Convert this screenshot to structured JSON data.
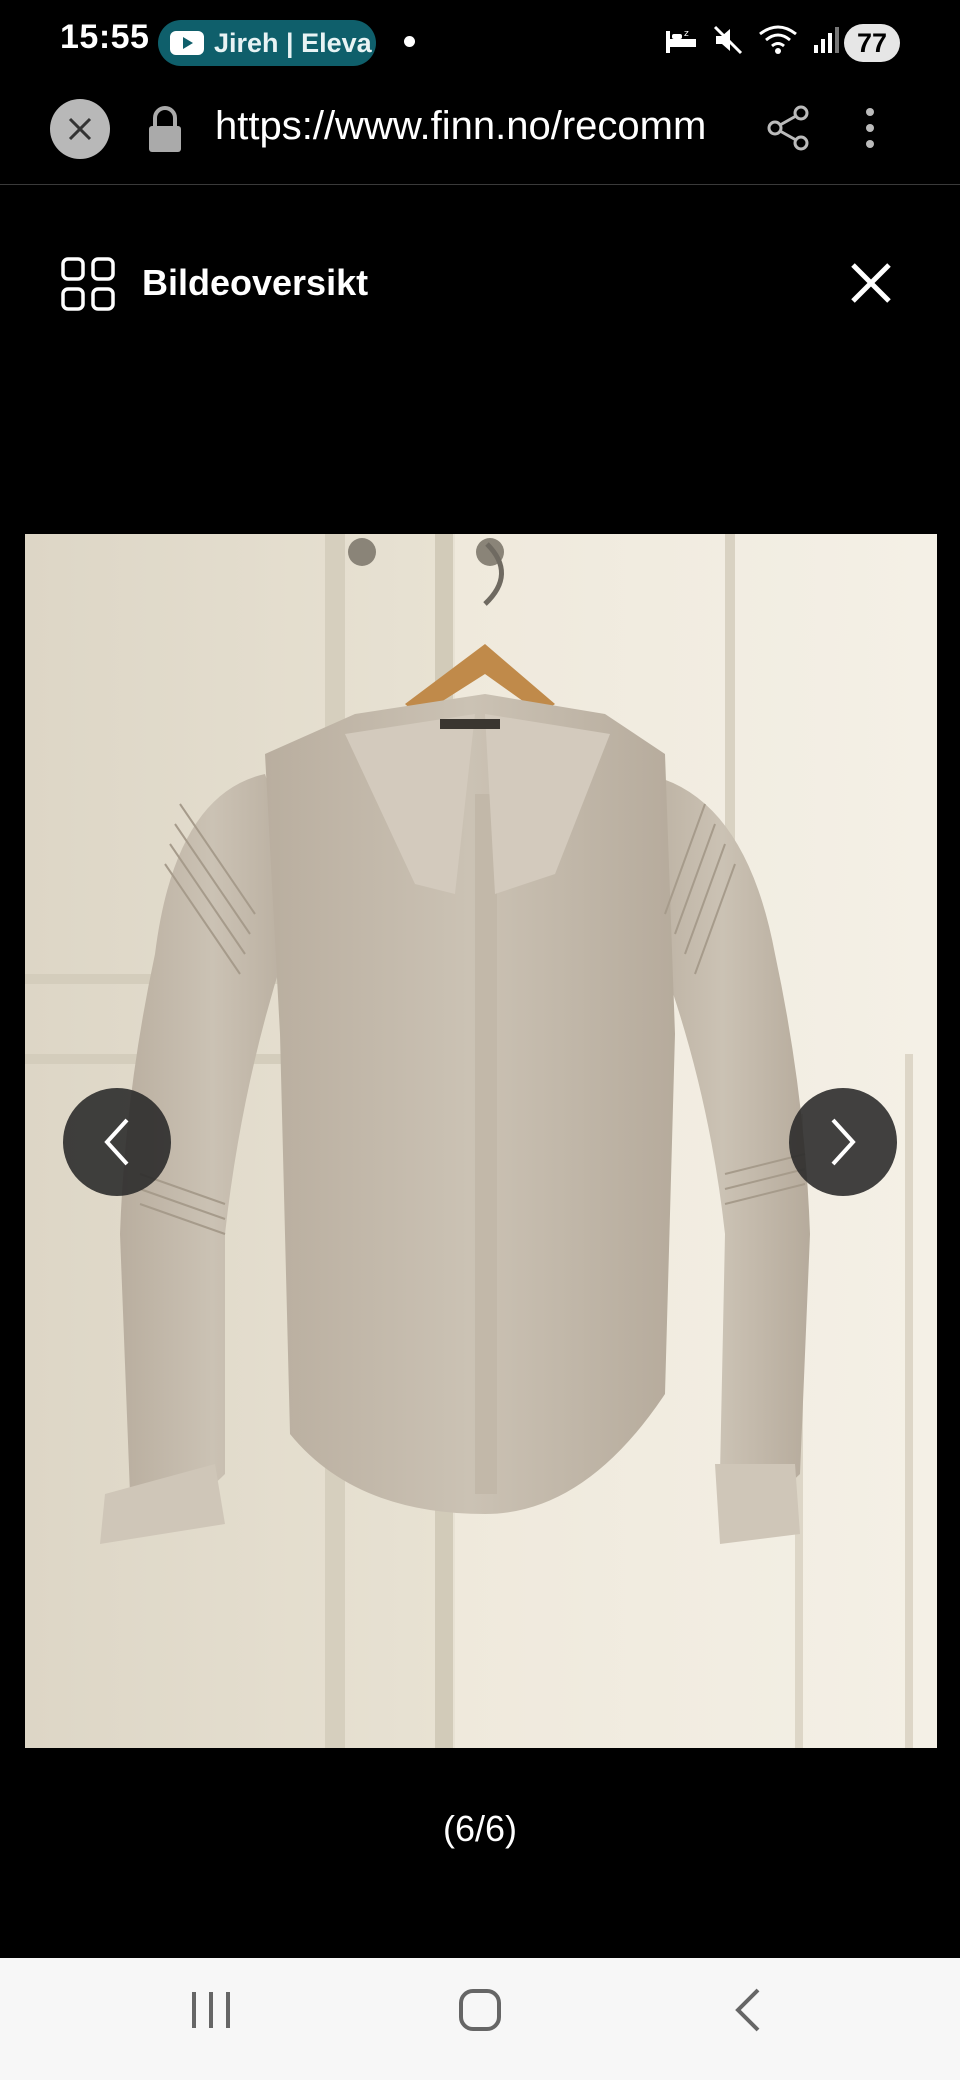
{
  "status_bar": {
    "time": "15:55",
    "media_text": "Jireh | Eleva",
    "battery": "77",
    "icons": [
      "youtube-icon",
      "sleep-icon",
      "mute-icon",
      "wifi-icon",
      "signal-icon"
    ]
  },
  "browser": {
    "url": "https://www.finn.no/recomm",
    "icons": [
      "close-icon",
      "lock-icon",
      "share-icon",
      "more-vert-icon"
    ]
  },
  "viewer": {
    "overview_label": "Bildeoversikt",
    "counter": "(6/6)",
    "icons": [
      "grid-icon",
      "close-icon",
      "chevron-left-icon",
      "chevron-right-icon"
    ]
  },
  "system_nav": {
    "icons": [
      "recents-icon",
      "home-icon",
      "back-icon"
    ]
  },
  "colors": {
    "background": "#000000",
    "media_pill": "#0f5f6b",
    "nav_bar": "#f7f7f7"
  }
}
